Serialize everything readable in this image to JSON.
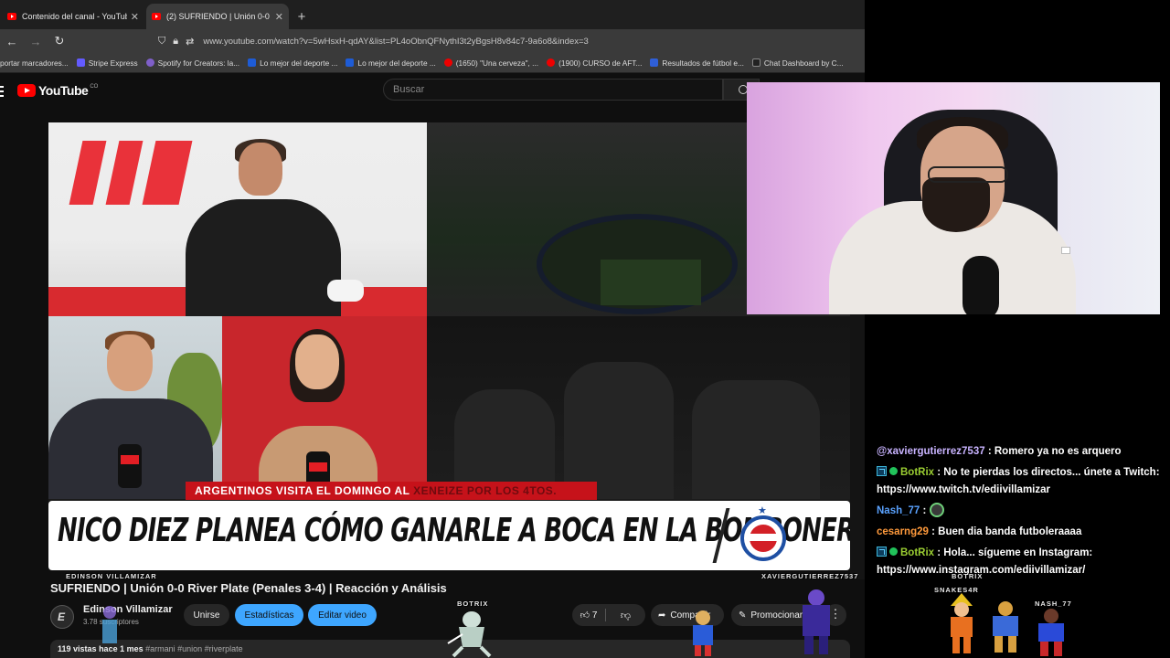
{
  "browser": {
    "tabs": [
      {
        "title": "Contenido del canal - YouTube",
        "active": false
      },
      {
        "title": "(2) SUFRIENDO | Unión 0-0 River",
        "active": true
      }
    ],
    "url": "www.youtube.com/watch?v=5wHsxH-qdAY&list=PL4oObnQFNythI3t2yBgsH8v84c7-9a6o8&index=3",
    "bookmarks": [
      "portar marcadores...",
      "Stripe Express",
      "Spotify for Creators: la...",
      "Lo mejor del deporte ...",
      "Lo mejor del deporte ...",
      "(1650) \"Una cerveza\", ...",
      "(1900) CURSO de AFT...",
      "Resultados de fútbol e...",
      "Chat Dashboard by C..."
    ]
  },
  "youtube": {
    "logo_text": "YouTube",
    "logo_country": "CO",
    "search_placeholder": "Buscar"
  },
  "video": {
    "ticker_text": "ARGENTINOS VISITA EL DOMINGO AL",
    "ticker_text_dim": "XENEIZE POR LOS 4TOS.",
    "banner_text": "NICO DIEZ PLANEA CÓMO GANARLE A BOCA EN LA BOMBONERA",
    "overlay_left": "EDINSON VILLAMIZAR",
    "overlay_right": "XAVIERGUTIERREZ7537"
  },
  "info": {
    "title": "SUFRIENDO | Unión 0-0 River Plate (Penales 3-4) | Reacción y Análisis",
    "channel_name": "Edinson Villamizar",
    "channel_subs": "3.78 suscriptores",
    "join_label": "Unirse",
    "stats_label": "Estadísticas",
    "edit_label": "Editar video",
    "like_count": "7",
    "share_label": "Compartir",
    "promo_label": "Promocionar",
    "more_label": "⋮",
    "views": "119 vistas",
    "age": "hace 1 mes",
    "hashtags": "#armani #union #riverplate"
  },
  "sprites": {
    "botrix_video": "BOTRIX",
    "botrix_chat": "BOTRIX",
    "snakes": "SNAKES4R",
    "nash": "NASH_77"
  },
  "chat": {
    "messages": [
      {
        "user": "@xaviergutierrez7537",
        "sep": " : ",
        "text": "Romero ya no es arquero",
        "color": "#c8b3ff",
        "badges": false
      },
      {
        "user": "BotRix",
        "sep": " : ",
        "text": "No te pierdas los directos... únete a Twitch: https://www.twitch.tv/ediivillamizar",
        "color": "#9acd32",
        "badges": true
      },
      {
        "user": "Nash_77",
        "sep": " : ",
        "text": "",
        "color": "#5aa2ff",
        "badges": false,
        "emote": true
      },
      {
        "user": "cesarng29",
        "sep": " : ",
        "text": "Buen dia banda futboleraaaa",
        "color": "#ff9a3c",
        "badges": false
      },
      {
        "user": "BotRix",
        "sep": " : ",
        "text": "Hola... sígueme en Instagram: https://www.instagram.com/ediivillamizar/",
        "color": "#9acd32",
        "badges": true
      }
    ]
  },
  "colors": {
    "youtube_red": "#ff0000",
    "primary_blue": "#3ea6ff",
    "chat_bg": "#000000",
    "page_bg": "#0f0f0f"
  }
}
